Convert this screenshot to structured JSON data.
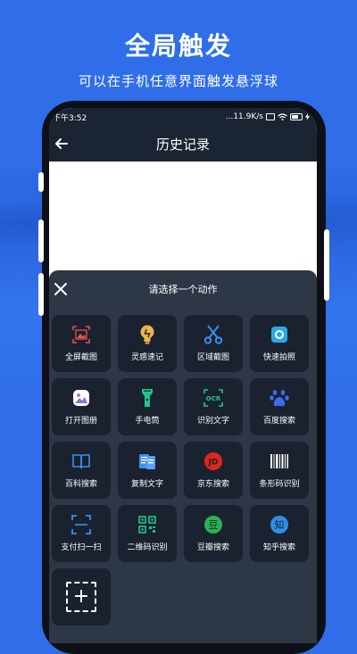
{
  "promo": {
    "headline": "全局触发",
    "subline": "可以在手机任意界面触发悬浮球"
  },
  "statusbar": {
    "time": "下午3:52",
    "network_speed": "...11.9K/s"
  },
  "appbar": {
    "title": "历史记录",
    "back_icon": "back-arrow-icon"
  },
  "sheet": {
    "title": "请选择一个动作",
    "close_icon": "close-icon",
    "actions": [
      {
        "label": "全屏截图",
        "icon": "fullscreen-screenshot-icon"
      },
      {
        "label": "灵感速记",
        "icon": "lightbulb-icon"
      },
      {
        "label": "区域截图",
        "icon": "scissors-icon"
      },
      {
        "label": "快速拍照",
        "icon": "camera-icon"
      },
      {
        "label": "打开图册",
        "icon": "gallery-icon"
      },
      {
        "label": "手电筒",
        "icon": "flashlight-icon"
      },
      {
        "label": "识别文字",
        "icon": "ocr-icon"
      },
      {
        "label": "百度搜索",
        "icon": "baidu-paw-icon"
      },
      {
        "label": "百科搜索",
        "icon": "book-icon"
      },
      {
        "label": "复制文字",
        "icon": "copy-text-icon"
      },
      {
        "label": "京东搜索",
        "icon": "jd-icon"
      },
      {
        "label": "条形码识别",
        "icon": "barcode-icon"
      },
      {
        "label": "支付扫一扫",
        "icon": "scan-frame-icon"
      },
      {
        "label": "二维码识别",
        "icon": "qrcode-icon"
      },
      {
        "label": "豆瓣搜索",
        "icon": "douban-icon"
      },
      {
        "label": "知乎搜索",
        "icon": "zhihu-icon"
      }
    ],
    "add_icon": "add-icon",
    "jd_glyph": "JD",
    "douban_glyph": "豆",
    "zhihu_glyph": "知",
    "ocr_glyph": "OCR"
  },
  "colors": {
    "background": "#2f6ee8",
    "dark_bar": "#1b2432",
    "sheet": "#2d3745",
    "tile": "#1a2230"
  }
}
